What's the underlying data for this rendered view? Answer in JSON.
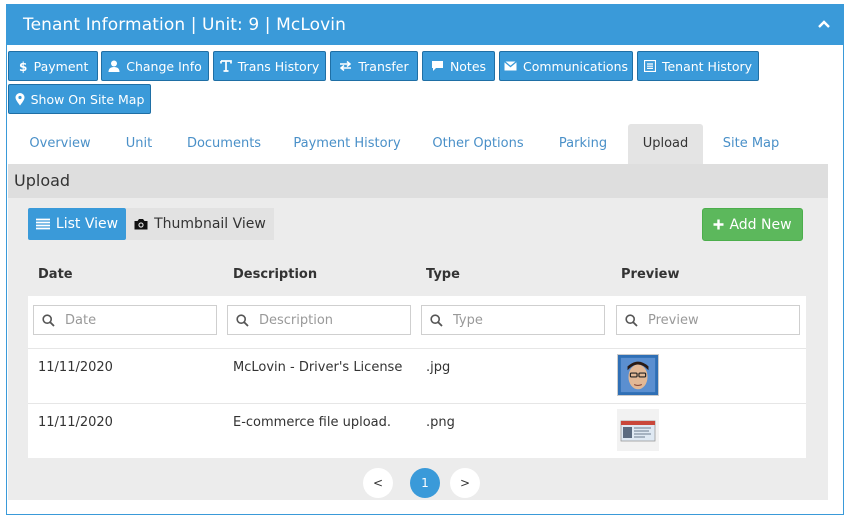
{
  "panel": {
    "title": "Tenant Information | Unit: 9 | McLovin"
  },
  "toolbar": {
    "buttons": [
      {
        "label": "Payment",
        "icon": "dollar-icon"
      },
      {
        "label": "Change Info",
        "icon": "user-icon"
      },
      {
        "label": "Trans History",
        "icon": "text-icon"
      },
      {
        "label": "Transfer",
        "icon": "transfer-icon"
      },
      {
        "label": "Notes",
        "icon": "comment-icon"
      },
      {
        "label": "Communications",
        "icon": "envelope-icon"
      },
      {
        "label": "Tenant History",
        "icon": "list-icon"
      },
      {
        "label": "Show On Site Map",
        "icon": "map-marker-icon"
      }
    ]
  },
  "tabs": [
    {
      "label": "Overview",
      "active": false
    },
    {
      "label": "Unit",
      "active": false
    },
    {
      "label": "Documents",
      "active": false
    },
    {
      "label": "Payment History",
      "active": false
    },
    {
      "label": "Other Options",
      "active": false
    },
    {
      "label": "Parking",
      "active": false
    },
    {
      "label": "Upload",
      "active": true
    },
    {
      "label": "Site Map",
      "active": false
    }
  ],
  "upload": {
    "section_title": "Upload",
    "list_view_label": "List View",
    "thumbnail_view_label": "Thumbnail View",
    "add_new_label": "Add New",
    "columns": [
      "Date",
      "Description",
      "Type",
      "Preview"
    ],
    "filters": {
      "date_placeholder": "Date",
      "description_placeholder": "Description",
      "type_placeholder": "Type",
      "preview_placeholder": "Preview"
    },
    "rows": [
      {
        "date": "11/11/2020",
        "description": "McLovin - Driver's License",
        "type": ".jpg",
        "preview": "photo-thumbnail"
      },
      {
        "date": "11/11/2020",
        "description": "E-commerce file upload.",
        "type": ".png",
        "preview": "license-thumbnail"
      }
    ]
  },
  "pagination": {
    "prev": "<",
    "current": "1",
    "next": ">"
  },
  "colors": {
    "primary": "#3a9ad9",
    "success": "#5cb85c",
    "section_bg": "#ececec"
  }
}
